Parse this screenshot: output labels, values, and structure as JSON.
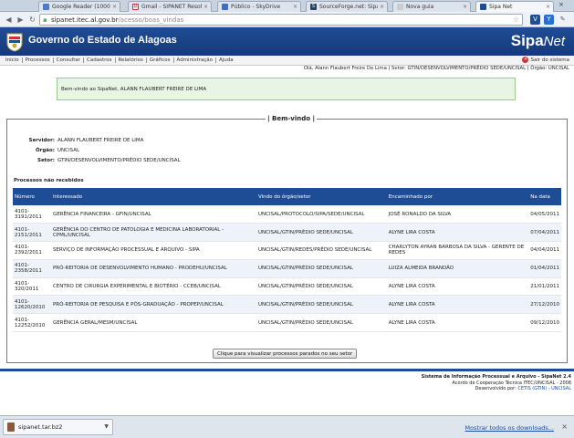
{
  "browser": {
    "tabs": [
      {
        "label": "Google Reader (1000+",
        "active": false
      },
      {
        "label": "Gmail - SIPANET Resolv",
        "active": false
      },
      {
        "label": "Público - SkyDrive",
        "active": false
      },
      {
        "label": "SourceForge.net: Sipa",
        "active": false
      },
      {
        "label": "Nova guia",
        "active": false
      },
      {
        "label": "Sipa Net",
        "active": true
      }
    ],
    "url_host": "sipanet.itec.al.gov.br",
    "url_path": "/acesso/boas_vindas"
  },
  "header": {
    "title": "Governo do Estado de Alagoas",
    "logo_main": "Sipa",
    "logo_net": "Net"
  },
  "menu": {
    "items": [
      "Inicio",
      "Processos",
      "Consultar",
      "Cadastros",
      "Relatórios",
      "Gráficos",
      "Administração",
      "Ajuda"
    ],
    "logout": "Sair do sistema"
  },
  "user_line": "Olá, Alann Flaubert Freire De Lima | Setor: GTIN/DESENVOLVIMENTO/PRÉDIO SEDE/UNCISAL | Órgão: UNCISAL",
  "welcome_message": "Bem-vindo ao SipaNet, ALANN FLAUBERT FREIRE DE LIMA",
  "panel": {
    "title": "| Bem-vindo |",
    "servidor_label": "Servidor:",
    "servidor": "ALANN FLAUBERT FREIRE DE LIMA",
    "orgao_label": "Órgão:",
    "orgao": "UNCISAL",
    "setor_label": "Setor:",
    "setor": "GTIN/DESENVOLVIMENTO/PRÉDIO SEDE/UNCISAL",
    "section_title": "Processos não recebidos",
    "columns": [
      "Número",
      "Interessado",
      "Vindo do órgão/setor",
      "Encaminhado por",
      "Na data"
    ],
    "rows": [
      [
        "4101-3191/2011",
        "GERÊNCIA FINANCEIRA - GFIN/UNCISAL",
        "UNCISAL/PROTOCOLO/SIPA/SEDE/UNCISAL",
        "JOSÉ RONALDO DA SILVA",
        "04/05/2011"
      ],
      [
        "4101-2151/2011",
        "GERÊNCIA DO CENTRO DE PATOLOGIA E MEDICINA LABORATORIAL - CPML/UNCISAL",
        "UNCISAL/GTIN/PRÉDIO SEDE/UNCISAL",
        "ALYNE LIRA COSTA",
        "07/04/2011"
      ],
      [
        "4101-2392/2011",
        "SERVIÇO DE INFORMAÇÃO PROCESSUAL E ARQUIVO - SIPA",
        "UNCISAL/GTIN/REDES/PRÉDIO SEDE/UNCISAL",
        "CHARLYTON AYRAN BARBOSA DA SILVA - GERENTE DE REDES",
        "04/04/2011"
      ],
      [
        "4101-2358/2011",
        "PRÓ-REITORIA DE DESENVOLVIMENTO HUMANO - PRODEHU/UNCISAL",
        "UNCISAL/GTIN/PRÉDIO SEDE/UNCISAL",
        "LUIZA ALMEIDA BRANDÃO",
        "01/04/2011"
      ],
      [
        "4101-320/2011",
        "CENTRO DE CIRURGIA EXPERIMENTAL E BIOTÉRIO - CCEB/UNCISAL",
        "UNCISAL/GTIN/PRÉDIO SEDE/UNCISAL",
        "ALYNE LIRA COSTA",
        "21/01/2011"
      ],
      [
        "4101-12620/2010",
        "PRÓ-REITORIA DE PESQUISA E PÓS-GRADUAÇÃO - PROPEP/UNCISAL",
        "UNCISAL/GTIN/PRÉDIO SEDE/UNCISAL",
        "ALYNE LIRA COSTA",
        "27/12/2010"
      ],
      [
        "4101-12252/2010",
        "GERÊNCIA GERAL/MESM/UNCISAL",
        "UNCISAL/GTIN/PRÉDIO SEDE/UNCISAL",
        "ALYNE LIRA COSTA",
        "09/12/2010"
      ]
    ],
    "button_label": "Clique para visualizar processos parados no seu setor"
  },
  "footer": {
    "line1": "Sistema de Informação Processual e Arquivo - SipaNet 2.4",
    "line2": "Acordo de Cooperação Técnica ITEC/UNCISAL - 2008",
    "line3_prefix": "Desenvolvido por:",
    "line3_link": "CETIS (GTIN) - UNCISAL"
  },
  "downloads": {
    "file": "sipanet.tar.bz2",
    "show_all": "Mostrar todos os downloads..."
  },
  "colors": {
    "header_blue": "#1f4d95",
    "welcome_green": "#e8f5e4"
  }
}
